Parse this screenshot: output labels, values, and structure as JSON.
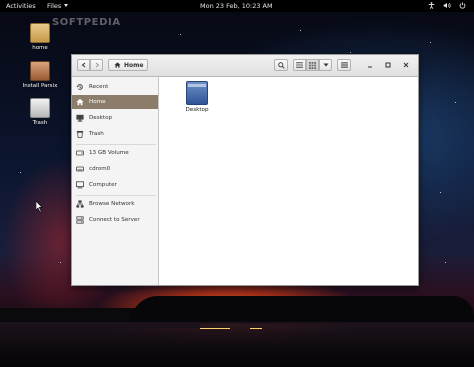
{
  "topbar": {
    "activities": "Activities",
    "app_menu": "Files",
    "clock": "Mon 23 Feb, 10:23 AM",
    "tray_icons": [
      "accessibility-icon",
      "volume-icon",
      "power-icon"
    ]
  },
  "watermark": "SOFTPEDIA",
  "desktop": {
    "icons": [
      {
        "label": "home",
        "icon": "home-folder-icon"
      },
      {
        "label": "Install Parsix",
        "icon": "installer-icon"
      },
      {
        "label": "Trash",
        "icon": "trash-icon"
      }
    ]
  },
  "window": {
    "path_label": "Home",
    "sidebar": [
      {
        "label": "Recent",
        "icon": "recent-icon"
      },
      {
        "label": "Home",
        "icon": "home-icon",
        "active": true
      },
      {
        "label": "Desktop",
        "icon": "desktop-icon"
      },
      {
        "label": "Trash",
        "icon": "trash-icon"
      },
      {
        "label": "13 GB Volume",
        "icon": "drive-icon"
      },
      {
        "label": "cdrom0",
        "icon": "cdrom-icon"
      },
      {
        "label": "Computer",
        "icon": "computer-icon"
      },
      {
        "label": "Browse Network",
        "icon": "network-icon"
      },
      {
        "label": "Connect to Server",
        "icon": "server-icon"
      }
    ],
    "files": [
      {
        "label": "Desktop",
        "icon": "folder-icon"
      }
    ]
  },
  "colors": {
    "sidebar_active": "#8c7d6b",
    "topbar_bg": "#000000"
  }
}
